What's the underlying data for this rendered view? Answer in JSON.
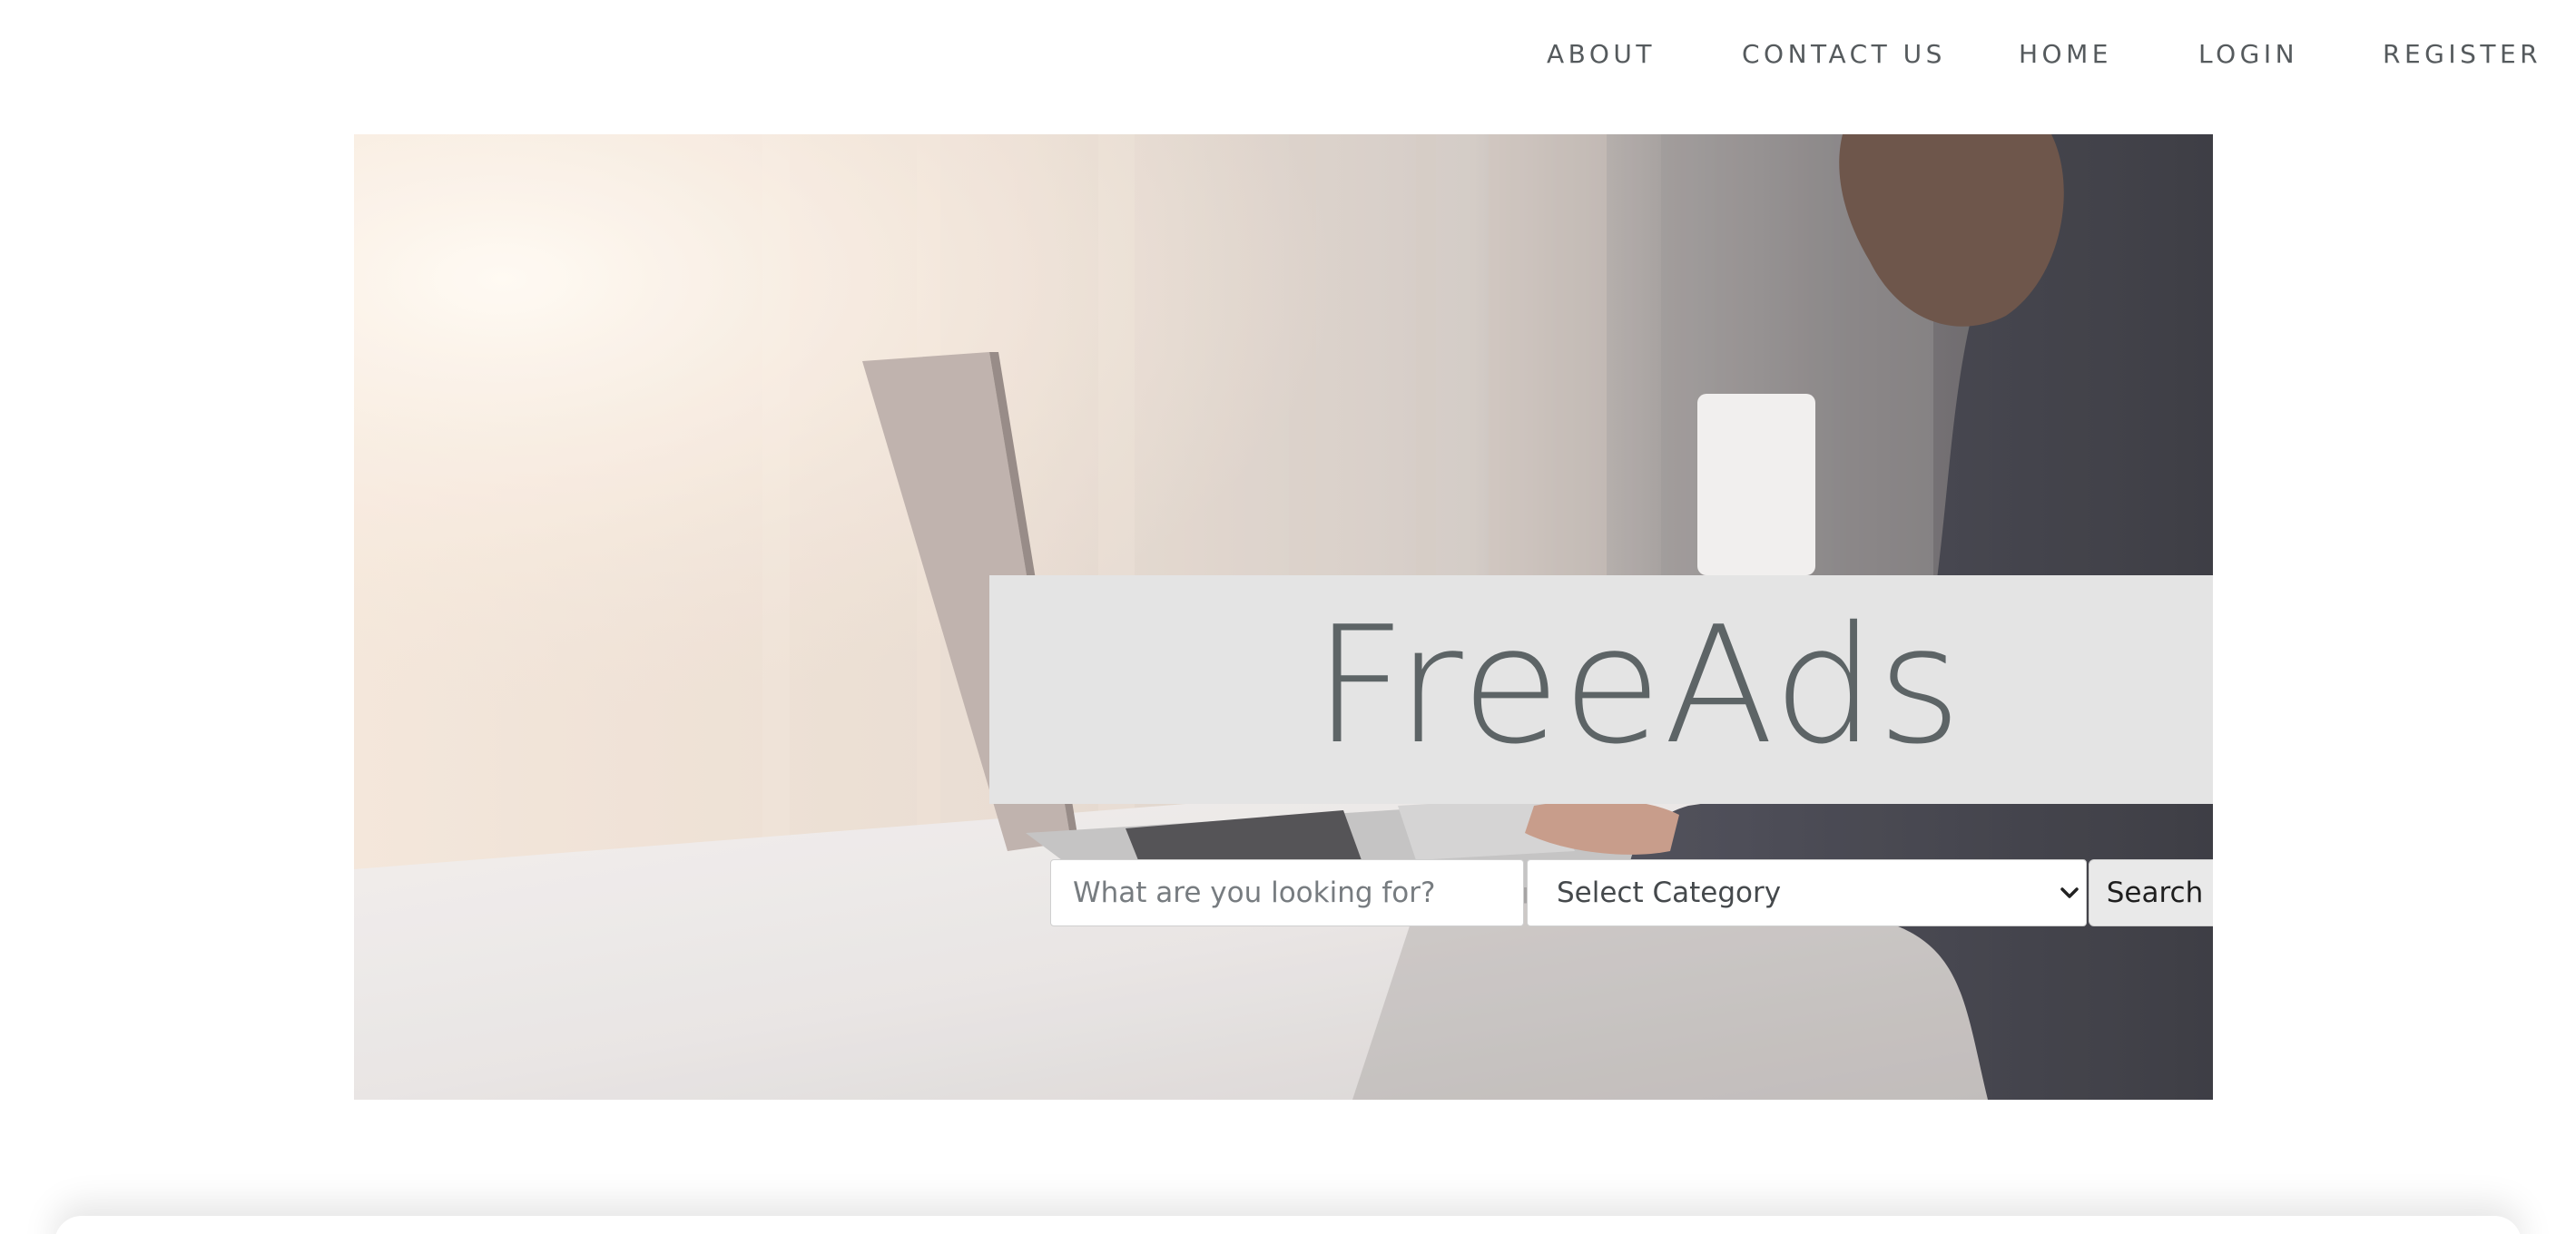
{
  "nav": {
    "items": [
      {
        "label": "ABOUT"
      },
      {
        "label": "CONTACT US"
      },
      {
        "label": "HOME"
      },
      {
        "label": "LOGIN"
      },
      {
        "label": "REGISTER"
      }
    ]
  },
  "hero": {
    "image_description_icon": "hero-photo",
    "title": "FreeAds"
  },
  "search": {
    "input_placeholder": "What are you looking for?",
    "input_value": "",
    "category_selected": "Select Category",
    "button_label": "Search"
  },
  "colors": {
    "nav_text": "#555a5d",
    "title_box_bg": "#e4e4e4",
    "title_text": "#5d6466",
    "button_bg": "#e9e9e9"
  }
}
